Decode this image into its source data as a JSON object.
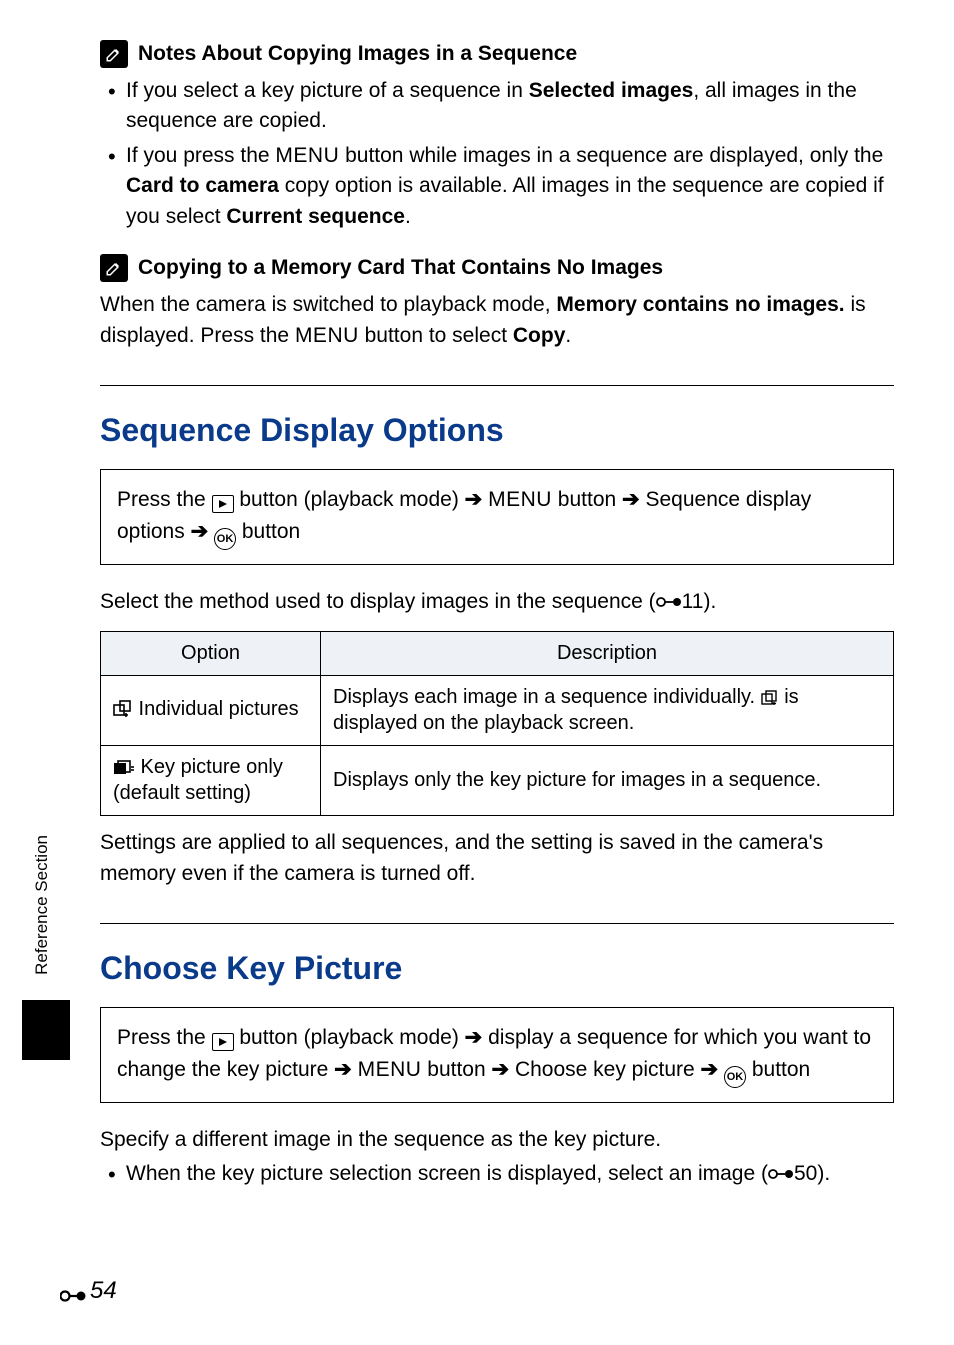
{
  "side": {
    "label": "Reference Section"
  },
  "note1": {
    "title": "Notes About Copying Images in a Sequence",
    "bullets": [
      {
        "pre": "If you select a key picture of a sequence in ",
        "bold1": "Selected images",
        "post1": ", all images in the sequence are copied."
      },
      {
        "pre": "If you press the ",
        "menu": "MENU",
        "mid": " button while images in a sequence are displayed, only the ",
        "bold1": "Card to camera",
        "mid2": " copy option is available. All images in the sequence are copied if you select ",
        "bold2": "Current sequence",
        "post": "."
      }
    ]
  },
  "note2": {
    "title": "Copying to a Memory Card That Contains No Images",
    "para_pre": "When the camera is switched to playback mode, ",
    "para_bold": "Memory contains no images.",
    "para_mid": " is displayed. Press the ",
    "para_menu": "MENU",
    "para_mid2": " button to select ",
    "para_bold2": "Copy",
    "para_post": "."
  },
  "sec1": {
    "heading": "Sequence Display Options",
    "nav_pre": "Press the ",
    "nav_play": "▶",
    "nav_mid1": " button (playback mode) ",
    "nav_menu": "MENU",
    "nav_mid2": " button ",
    "nav_target": " Sequence display options ",
    "nav_ok": "OK",
    "nav_post": " button",
    "lead_pre": "Select the method used to display images in the sequence (",
    "lead_ref": "11",
    "lead_post": ").",
    "table": {
      "h1": "Option",
      "h2": "Description",
      "r1_opt": " Individual pictures",
      "r1_desc_pre": "Displays each image in a sequence individually. ",
      "r1_desc_post": " is displayed on the playback screen.",
      "r2_opt": " Key picture only (default setting)",
      "r2_desc": "Displays only the key picture for images in a sequence."
    },
    "tail": "Settings are applied to all sequences, and the setting is saved in the camera's memory even if the camera is turned off."
  },
  "sec2": {
    "heading": "Choose Key Picture",
    "nav_pre": "Press the ",
    "nav_mid1": " button (playback mode) ",
    "nav_mid2": " display a sequence for which you want to change the key picture ",
    "nav_menu": "MENU",
    "nav_mid3": " button ",
    "nav_target": " Choose key picture ",
    "nav_ok": "OK",
    "nav_post": " button",
    "para": "Specify a different image in the sequence as the key picture.",
    "bullet_pre": "When the key picture selection screen is displayed, select an image (",
    "bullet_ref": "50",
    "bullet_post": ")."
  },
  "pageNumber": "54"
}
